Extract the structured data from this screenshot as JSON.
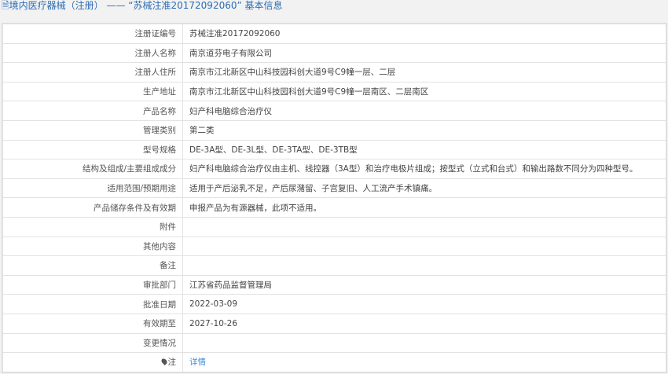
{
  "header": {
    "icon": "document-icon",
    "title": "境内医疗器械（注册） —— “苏械注准20172092060” 基本信息"
  },
  "rows": [
    {
      "label": "注册证编号",
      "value": "苏械注准20172092060"
    },
    {
      "label": "注册人名称",
      "value": "南京道芬电子有限公司"
    },
    {
      "label": "注册人住所",
      "value": "南京市江北新区中山科技园科创大道9号C9幢一层、二层"
    },
    {
      "label": "生产地址",
      "value": "南京市江北新区中山科技园科创大道9号C9幢一层南区、二层南区"
    },
    {
      "label": "产品名称",
      "value": "妇产科电脑综合治疗仪"
    },
    {
      "label": "管理类别",
      "value": "第二类"
    },
    {
      "label": "型号规格",
      "value": "DE-3A型、DE-3L型、DE-3TA型、DE-3TB型"
    },
    {
      "label": "结构及组成/主要组成成分",
      "value": "妇产科电脑综合治疗仪由主机、线控器（3A型）和治疗电极片组成；按型式（立式和台式）和输出路数不同分为四种型号。"
    },
    {
      "label": "适用范围/预期用途",
      "value": "适用于产后泌乳不足，产后尿潴留、子宫复旧、人工流产手术镇痛。"
    },
    {
      "label": "产品储存条件及有效期",
      "value": "申报产品为有源器械，此项不适用。"
    },
    {
      "label": "附件",
      "value": ""
    },
    {
      "label": "其他内容",
      "value": ""
    },
    {
      "label": "备注",
      "value": ""
    },
    {
      "label": "审批部门",
      "value": "江苏省药品监督管理局"
    },
    {
      "label": "批准日期",
      "value": "2022-03-09"
    },
    {
      "label": "有效期至",
      "value": "2027-10-26"
    },
    {
      "label": "变更情况",
      "value": ""
    }
  ],
  "last": {
    "label": "注",
    "icon": "pin-icon",
    "link": "详情"
  }
}
